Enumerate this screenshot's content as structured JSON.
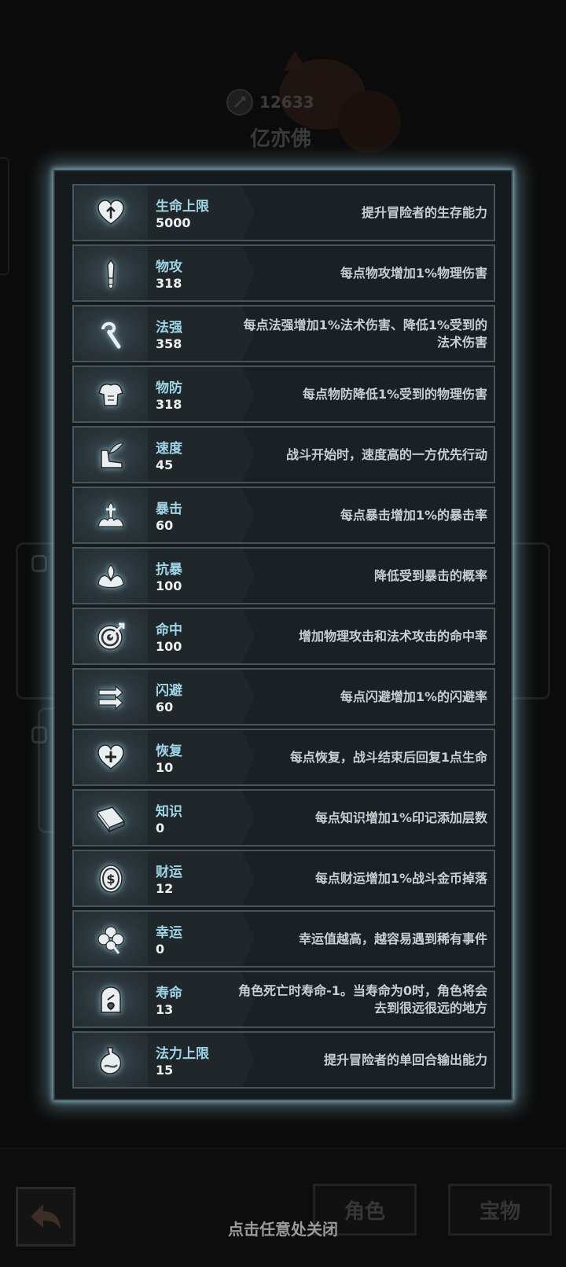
{
  "background": {
    "power_value": "12633",
    "character_name": "亿亦佛",
    "tabs": [
      "角色",
      "宝物"
    ]
  },
  "stats": [
    {
      "icon": "heart-arrow-icon",
      "name": "生命上限",
      "value": "5000",
      "desc": "提升冒险者的生存能力"
    },
    {
      "icon": "sword-icon",
      "name": "物攻",
      "value": "318",
      "desc": "每点物攻增加1%物理伤害"
    },
    {
      "icon": "staff-icon",
      "name": "法强",
      "value": "358",
      "desc": "每点法强增加1%法术伤害、降低1%受到的法术伤害"
    },
    {
      "icon": "armor-icon",
      "name": "物防",
      "value": "318",
      "desc": "每点物防降低1%受到的物理伤害"
    },
    {
      "icon": "winged-boot-icon",
      "name": "速度",
      "value": "45",
      "desc": "战斗开始时，速度高的一方优先行动"
    },
    {
      "icon": "critical-strike-icon",
      "name": "暴击",
      "value": "60",
      "desc": "每点暴击增加1%的暴击率"
    },
    {
      "icon": "crit-resist-icon",
      "name": "抗暴",
      "value": "100",
      "desc": "降低受到暴击的概率"
    },
    {
      "icon": "target-icon",
      "name": "命中",
      "value": "100",
      "desc": "增加物理攻击和法术攻击的命中率"
    },
    {
      "icon": "dodge-arrows-icon",
      "name": "闪避",
      "value": "60",
      "desc": "每点闪避增加1%的闪避率"
    },
    {
      "icon": "heart-plus-icon",
      "name": "恢复",
      "value": "10",
      "desc": "每点恢复，战斗结束后回复1点生命"
    },
    {
      "icon": "book-icon",
      "name": "知识",
      "value": "0",
      "desc": "每点知识增加1%印记添加层数"
    },
    {
      "icon": "coin-icon",
      "name": "财运",
      "value": "12",
      "desc": "每点财运增加1%战斗金币掉落"
    },
    {
      "icon": "clover-icon",
      "name": "幸运",
      "value": "0",
      "desc": "幸运值越高，越容易遇到稀有事件"
    },
    {
      "icon": "tombstone-icon",
      "name": "寿命",
      "value": "13",
      "desc": "角色死亡时寿命-1。当寿命为0时，角色将会去到很远很远的地方"
    },
    {
      "icon": "mana-flask-icon",
      "name": "法力上限",
      "value": "15",
      "desc": "提升冒险者的单回合输出能力"
    }
  ],
  "close_hint": "点击任意处关闭"
}
